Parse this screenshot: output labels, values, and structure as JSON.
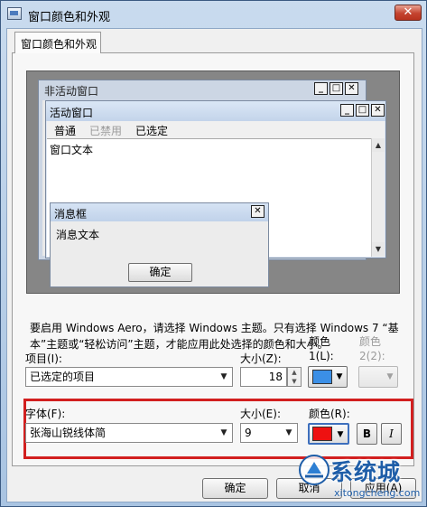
{
  "window": {
    "title": "窗口颜色和外观",
    "close_glyph": "✕"
  },
  "tab": {
    "label": "窗口颜色和外观"
  },
  "preview": {
    "inactive_title": "非活动窗口",
    "active_title": "活动窗口",
    "title_controls": [
      "_",
      "□",
      "✕"
    ],
    "menu": {
      "normal": "普通",
      "disabled": "已禁用",
      "selected": "已选定"
    },
    "window_text": "窗口文本",
    "message_box": {
      "title": "消息框",
      "text": "消息文本",
      "ok": "确定"
    }
  },
  "description": "要启用 Windows Aero，请选择 Windows 主题。只有选择 Windows 7 “基本”主题或“轻松访问”主题，才能应用此处选择的颜色和大小。",
  "item_row": {
    "item_label": "项目(I):",
    "item_value": "已选定的项目",
    "size_label": "大小(Z):",
    "size_value": "18",
    "color1_label_line1": "颜色",
    "color1_label_line2": "1(L):",
    "color2_label_line1": "颜色",
    "color2_label_line2": "2(2):"
  },
  "font_row": {
    "font_label": "字体(F):",
    "font_value": "张海山锐线体简",
    "size_label": "大小(E):",
    "size_value": "9",
    "color_label": "颜色(R):",
    "bold": "B",
    "italic": "I"
  },
  "buttons": {
    "ok": "确定",
    "cancel": "取消",
    "apply": "应用(A)"
  },
  "colors": {
    "color1_swatch": "#3b8fe6",
    "font_color_swatch": "#ee1111",
    "highlight_border": "#d21f1f"
  },
  "watermark": {
    "brand": "系统城",
    "url": "xitongcheng.com"
  }
}
